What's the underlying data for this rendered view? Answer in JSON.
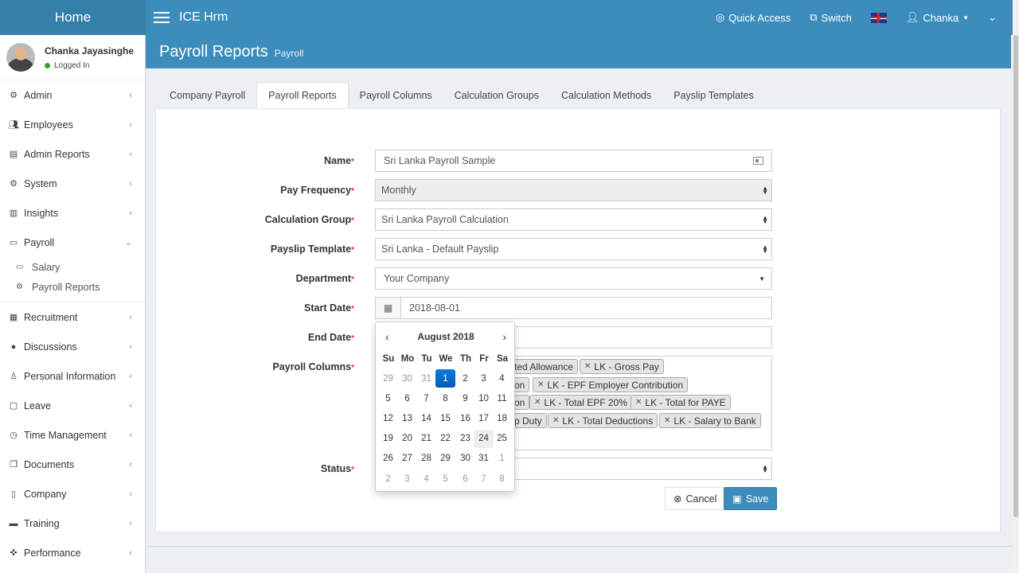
{
  "topbar": {
    "logo": "Home",
    "app_name": "ICE Hrm",
    "quick_access": "Quick Access",
    "switch": "Switch",
    "user": "Chanka"
  },
  "sidebar": {
    "user_name": "Chanka Jayasinghe",
    "user_status": "Logged In",
    "items": [
      {
        "label": "Admin",
        "icon": "cubes-icon"
      },
      {
        "label": "Employees",
        "icon": "users-icon"
      },
      {
        "label": "Admin Reports",
        "icon": "file-icon"
      },
      {
        "label": "System",
        "icon": "cogs-icon"
      },
      {
        "label": "Insights",
        "icon": "bar-chart-icon"
      },
      {
        "label": "Payroll",
        "icon": "money-icon"
      }
    ],
    "payroll_sub": [
      {
        "label": "Salary",
        "icon": "money-icon"
      },
      {
        "label": "Payroll Reports",
        "icon": "cogs-icon"
      }
    ],
    "items_after": [
      {
        "label": "Recruitment",
        "icon": "table-icon"
      },
      {
        "label": "Discussions",
        "icon": "comments-icon"
      },
      {
        "label": "Personal Information",
        "icon": "male-icon"
      },
      {
        "label": "Leave",
        "icon": "calendar-icon"
      },
      {
        "label": "Time Management",
        "icon": "clock-icon"
      },
      {
        "label": "Documents",
        "icon": "files-icon"
      },
      {
        "label": "Company",
        "icon": "building-icon"
      },
      {
        "label": "Training",
        "icon": "briefcase-icon"
      },
      {
        "label": "Performance",
        "icon": "crosshair-icon"
      }
    ]
  },
  "header": {
    "title": "Payroll Reports",
    "subtitle": "Payroll"
  },
  "tabs": [
    "Company Payroll",
    "Payroll Reports",
    "Payroll Columns",
    "Calculation Groups",
    "Calculation Methods",
    "Payslip Templates"
  ],
  "form": {
    "name_label": "Name",
    "name_value": "Sri Lanka Payroll Sample",
    "freq_label": "Pay Frequency",
    "freq_value": "Monthly",
    "group_label": "Calculation Group",
    "group_value": "Sri Lanka Payroll Calculation",
    "payslip_label": "Payslip Template",
    "payslip_value": "Sri Lanka - Default Payslip",
    "dept_label": "Department",
    "dept_value": "Your Company",
    "start_label": "Start Date",
    "start_value": "2018-08-01",
    "end_label": "End Date",
    "columns_label": "Payroll Columns",
    "status_label": "Status",
    "required_mark": "*",
    "tags": [
      "ted Allowance",
      "LK - Gross Pay",
      "on",
      "LK - EPF Employer Contribution",
      "on",
      "LK - Total EPF 20%",
      "LK - Total for PAYE",
      "p Duty",
      "LK - Total Deductions",
      "LK - Salary to Bank"
    ],
    "cancel": "Cancel",
    "save": "Save"
  },
  "calendar": {
    "month": "August 2018",
    "prev": "‹",
    "next": "›",
    "days_of_week": [
      "Su",
      "Mo",
      "Tu",
      "We",
      "Th",
      "Fr",
      "Sa"
    ],
    "weeks": [
      [
        "29",
        "30",
        "31",
        "1",
        "2",
        "3",
        "4"
      ],
      [
        "5",
        "6",
        "7",
        "8",
        "9",
        "10",
        "11"
      ],
      [
        "12",
        "13",
        "14",
        "15",
        "16",
        "17",
        "18"
      ],
      [
        "19",
        "20",
        "21",
        "22",
        "23",
        "24",
        "25"
      ],
      [
        "26",
        "27",
        "28",
        "29",
        "30",
        "31",
        "1"
      ],
      [
        "2",
        "3",
        "4",
        "5",
        "6",
        "7",
        "8"
      ]
    ],
    "selected": "1",
    "today": "24"
  },
  "colors": {
    "brand": "#3c8dbc",
    "brand_dark": "#367fa9",
    "selected_day": "#0a6fd1",
    "required": "#dd3333"
  }
}
